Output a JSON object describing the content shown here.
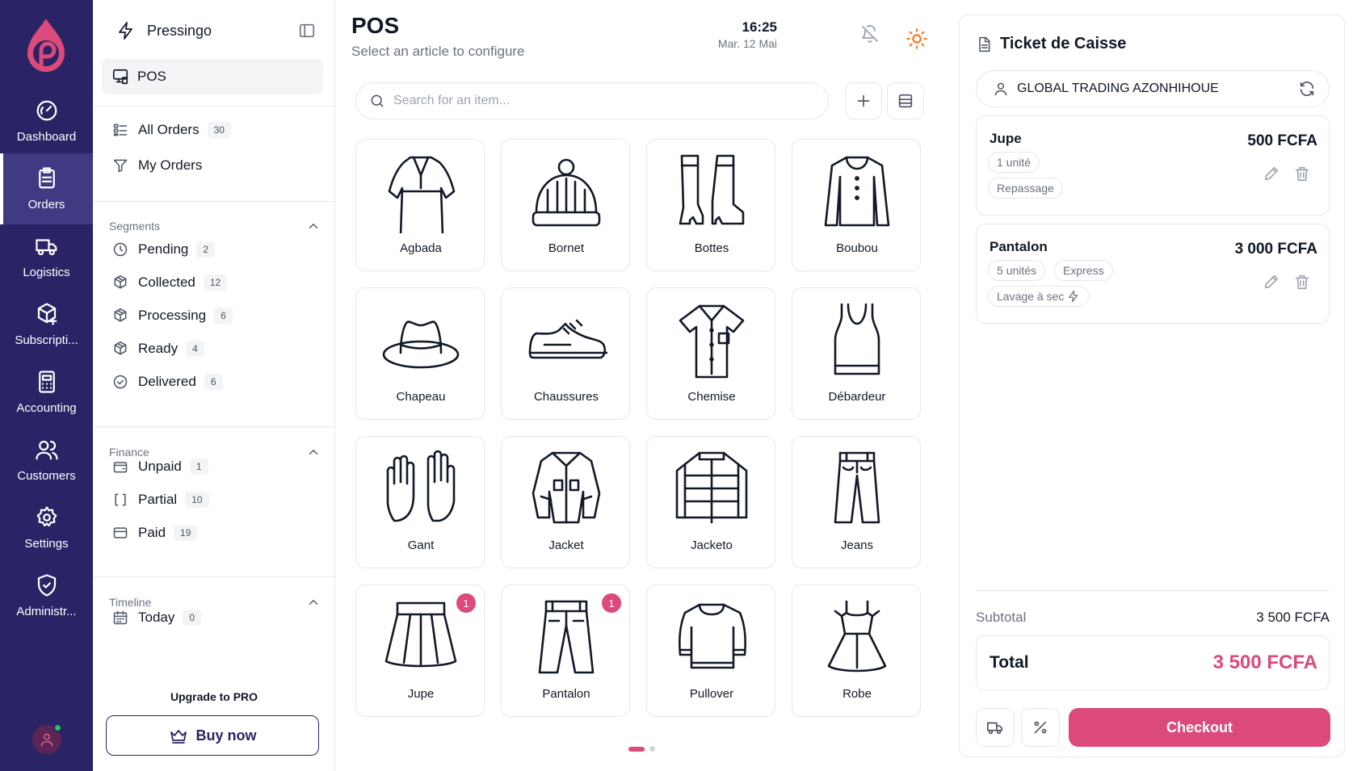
{
  "colors": {
    "rail_bg": "#2a2466",
    "rail_active": "#3f3a82",
    "accent": "#db4a7a",
    "sun": "#f97316",
    "online": "#22c55e"
  },
  "rail": {
    "logo_icon": "pressingo-drop-logo",
    "items": [
      {
        "label": "Dashboard",
        "icon": "gauge-icon"
      },
      {
        "label": "Orders",
        "icon": "clipboard-icon",
        "active": true
      },
      {
        "label": "Logistics",
        "icon": "truck-icon"
      },
      {
        "label": "Subscripti...",
        "icon": "package-plus-icon"
      },
      {
        "label": "Accounting",
        "icon": "calculator-icon"
      },
      {
        "label": "Customers",
        "icon": "users-icon"
      },
      {
        "label": "Settings",
        "icon": "gear-icon"
      },
      {
        "label": "Administr...",
        "icon": "shield-icon"
      }
    ]
  },
  "sidebar": {
    "app_name": "Pressingo",
    "pos_label": "POS",
    "orders": [
      {
        "label": "All Orders",
        "count": "30",
        "icon": "list-icon"
      },
      {
        "label": "My Orders",
        "count": "",
        "icon": "filter-icon"
      }
    ],
    "segments": {
      "title": "Segments",
      "items": [
        {
          "label": "Pending",
          "count": "2",
          "icon": "clock-icon"
        },
        {
          "label": "Collected",
          "count": "12",
          "icon": "box-icon"
        },
        {
          "label": "Processing",
          "count": "6",
          "icon": "box-icon"
        },
        {
          "label": "Ready",
          "count": "4",
          "icon": "box-icon"
        },
        {
          "label": "Delivered",
          "count": "6",
          "icon": "check-circle-icon"
        }
      ]
    },
    "finance": {
      "title": "Finance",
      "items": [
        {
          "label": "Unpaid",
          "count": "1",
          "icon": "wallet-icon"
        },
        {
          "label": "Partial",
          "count": "10",
          "icon": "brackets-icon"
        },
        {
          "label": "Paid",
          "count": "19",
          "icon": "card-icon"
        }
      ]
    },
    "timeline": {
      "title": "Timeline",
      "items": [
        {
          "label": "Today",
          "count": "0",
          "icon": "calendar-icon"
        }
      ]
    },
    "upgrade_label": "Upgrade to PRO",
    "buy_label": "Buy now"
  },
  "main": {
    "title": "POS",
    "subtitle": "Select an article to configure",
    "time": "16:25",
    "date": "Mar. 12 Mai",
    "search_placeholder": "Search for an item...",
    "articles": [
      {
        "name": "Agbada",
        "icon": "agbada-icon"
      },
      {
        "name": "Bornet",
        "icon": "beanie-icon"
      },
      {
        "name": "Bottes",
        "icon": "boots-icon"
      },
      {
        "name": "Boubou",
        "icon": "boubou-icon"
      },
      {
        "name": "Chapeau",
        "icon": "hat-icon"
      },
      {
        "name": "Chaussures",
        "icon": "sneaker-icon"
      },
      {
        "name": "Chemise",
        "icon": "shirt-icon"
      },
      {
        "name": "Débardeur",
        "icon": "tank-top-icon"
      },
      {
        "name": "Gant",
        "icon": "gloves-icon"
      },
      {
        "name": "Jacket",
        "icon": "jacket-icon"
      },
      {
        "name": "Jacketo",
        "icon": "puffer-jacket-icon"
      },
      {
        "name": "Jeans",
        "icon": "jeans-icon"
      },
      {
        "name": "Jupe",
        "icon": "skirt-icon",
        "badge": "1"
      },
      {
        "name": "Pantalon",
        "icon": "trousers-icon",
        "badge": "1"
      },
      {
        "name": "Pullover",
        "icon": "sweater-icon"
      },
      {
        "name": "Robe",
        "icon": "dress-icon"
      }
    ]
  },
  "ticket": {
    "title": "Ticket de Caisse",
    "customer": "GLOBAL TRADING AZONHIHOUE",
    "items": [
      {
        "name": "Jupe",
        "price": "500 FCFA",
        "qty": "1 unité",
        "options": [],
        "service": "Repassage",
        "service_icon": ""
      },
      {
        "name": "Pantalon",
        "price": "3 000 FCFA",
        "qty": "5 unités",
        "options": [
          "Express"
        ],
        "service": "Lavage à sec",
        "service_icon": "bolt-icon"
      }
    ],
    "subtotal_label": "Subtotal",
    "subtotal": "3 500 FCFA",
    "total_label": "Total",
    "total": "3 500 FCFA",
    "checkout_label": "Checkout"
  }
}
